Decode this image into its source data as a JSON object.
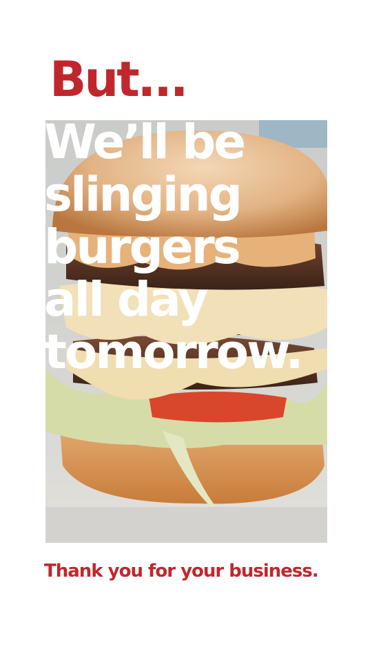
{
  "headline": {
    "intro": "But...",
    "lines": [
      "We’ll be",
      "slinging",
      "burgers",
      "all day",
      "tomorrow."
    ]
  },
  "footer": {
    "text": "Thank you for your business."
  },
  "photo": {
    "icon": "burger-photo"
  },
  "colors": {
    "accent": "#c0272d",
    "text_overlay": "#ffffff",
    "background": "#ffffff"
  }
}
